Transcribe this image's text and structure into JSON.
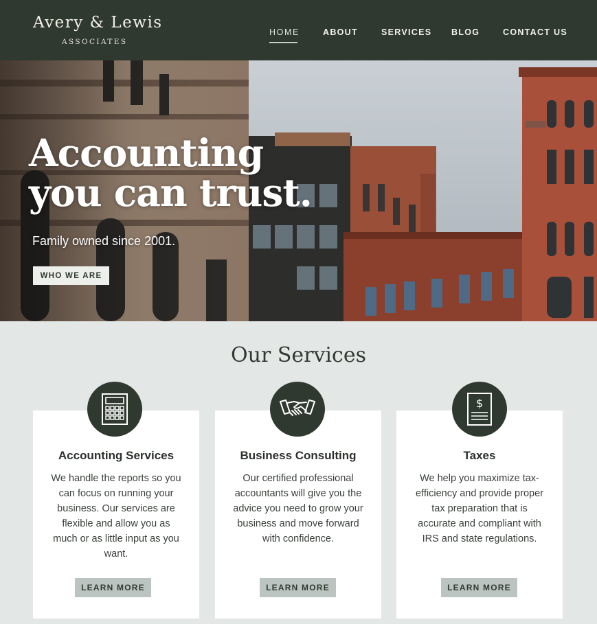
{
  "header": {
    "logo_title": "Avery & Lewis",
    "logo_subtitle": "ASSOCIATES",
    "nav": [
      "HOME",
      "ABOUT",
      "SERVICES",
      "BLOG",
      "CONTACT US"
    ],
    "active_nav": "HOME"
  },
  "hero": {
    "title": "Accounting\nyou can trust.",
    "subtitle": "Family owned since 2001.",
    "button": "WHO WE ARE"
  },
  "services": {
    "title": "Our Services",
    "cards": [
      {
        "icon": "calculator-icon",
        "title": "Accounting Services",
        "text": "We handle the reports so you can focus on running your business. Our services are flexible and allow you as much or as little input as you want.",
        "button": "LEARN MORE"
      },
      {
        "icon": "handshake-icon",
        "title": "Business Consulting",
        "text": "Our certified professional accountants will give you the advice you need to grow your business and move forward with confidence.",
        "button": "LEARN MORE"
      },
      {
        "icon": "tax-document-icon",
        "title": "Taxes",
        "text": "We help you maximize tax-efficiency and provide proper tax preparation that is accurate and compliant with IRS and state regulations.",
        "button": "LEARN MORE"
      }
    ]
  },
  "colors": {
    "header_bg": "#30392f",
    "page_bg": "#e3e7e6",
    "button_bg": "#bcc4c1",
    "accent_dark": "#30392f"
  }
}
